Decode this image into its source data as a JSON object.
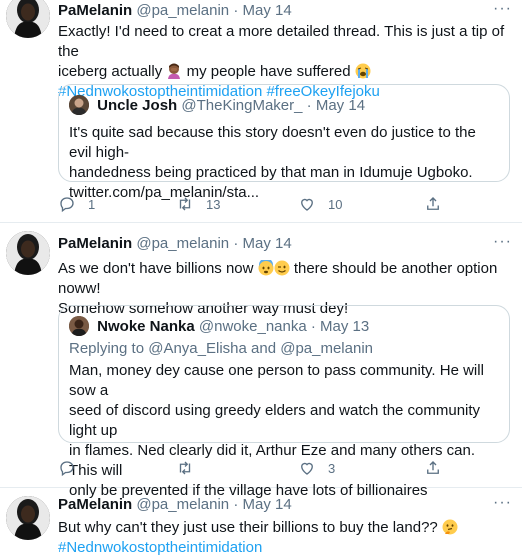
{
  "tweets": [
    {
      "author_name": "PaMelanin",
      "handle": "@pa_melanin",
      "dot": "·",
      "date": "May 14",
      "text_line1": "Exactly! I'd need to creat a more detailed thread. This is just a tip of the",
      "text_line2": "iceberg actually",
      "text_line2b": "my people have suffered",
      "hashtag1": "#Nednwokostoptheintimidation",
      "hashtag2": "#freeOkeyIfejoku",
      "quote": {
        "author_name": "Uncle Josh",
        "handle": "@TheKingMaker_",
        "dot": "·",
        "date": "May 14",
        "line1": "It's quite sad because this story doesn't even do justice to the evil high-",
        "line2": "handedness being practiced by that man in Idumuje Ugboko.",
        "line3": "twitter.com/pa_melanin/sta..."
      },
      "reply_count": "1",
      "retweet_count": "13",
      "like_count": "10"
    },
    {
      "author_name": "PaMelanin",
      "handle": "@pa_melanin",
      "dot": "·",
      "date": "May 14",
      "text_line1a": "As we don't have billions now",
      "text_line1b": "there should be another option noww!",
      "text_line2": "Somehow somehow another way must dey!",
      "quote": {
        "author_name": "Nwoke Nanka",
        "handle": "@nwoke_nanka",
        "dot": "·",
        "date": "May 13",
        "replying_prefix": "Replying to",
        "replying_to1": "@Anya_Elisha",
        "replying_and": "and",
        "replying_to2": "@pa_melanin",
        "line1": "Man, money dey cause one person to pass community. He will sow a",
        "line2": "seed of discord using greedy elders and watch the community light up",
        "line3": "in flames. Ned clearly did it, Arthur Eze and many others can. This will",
        "line4": "only be prevented if the village have lots of billionaires"
      },
      "like_count": "3"
    },
    {
      "author_name": "PaMelanin",
      "handle": "@pa_melanin",
      "dot": "·",
      "date": "May 14",
      "text_line1": "But why can't they just use their billions to buy the land??",
      "hashtag1": "#Nednwokostoptheintimidation"
    }
  ],
  "more_label": "···",
  "colors": {
    "link": "#1da1f2",
    "muted": "#5b7083",
    "border": "#cfd9de"
  },
  "icons": [
    "reply-icon",
    "retweet-icon",
    "like-icon",
    "share-icon",
    "more-icon",
    "emoji-woman-facepalming",
    "emoji-loudly-crying",
    "emoji-fearful",
    "emoji-wink",
    "emoji-thinking"
  ]
}
